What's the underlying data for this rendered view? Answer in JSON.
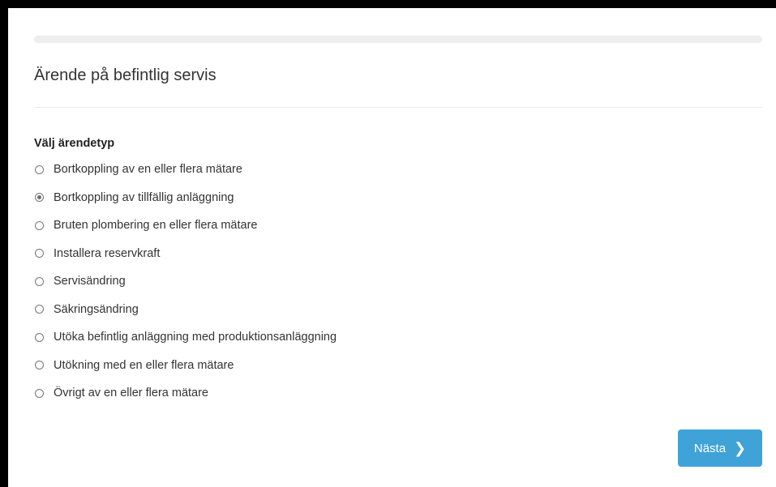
{
  "page": {
    "title": "Ärende på befintlig servis"
  },
  "form": {
    "label": "Välj ärendetyp",
    "options": [
      {
        "label": "Bortkoppling av en eller flera mätare",
        "selected": false
      },
      {
        "label": "Bortkoppling av tillfällig anläggning",
        "selected": true
      },
      {
        "label": "Bruten plombering en eller flera mätare",
        "selected": false
      },
      {
        "label": "Installera reservkraft",
        "selected": false
      },
      {
        "label": "Servisändring",
        "selected": false
      },
      {
        "label": "Säkringsändring",
        "selected": false
      },
      {
        "label": "Utöka befintlig anläggning med produktionsanläggning",
        "selected": false
      },
      {
        "label": "Utökning med en eller flera mätare",
        "selected": false
      },
      {
        "label": "Övrigt av en eller flera mätare",
        "selected": false
      }
    ]
  },
  "actions": {
    "next_label": "Nästa",
    "next_icon": "chevron-right-icon"
  },
  "colors": {
    "primary_button": "#3fa3d8",
    "window_border": "#000000"
  }
}
